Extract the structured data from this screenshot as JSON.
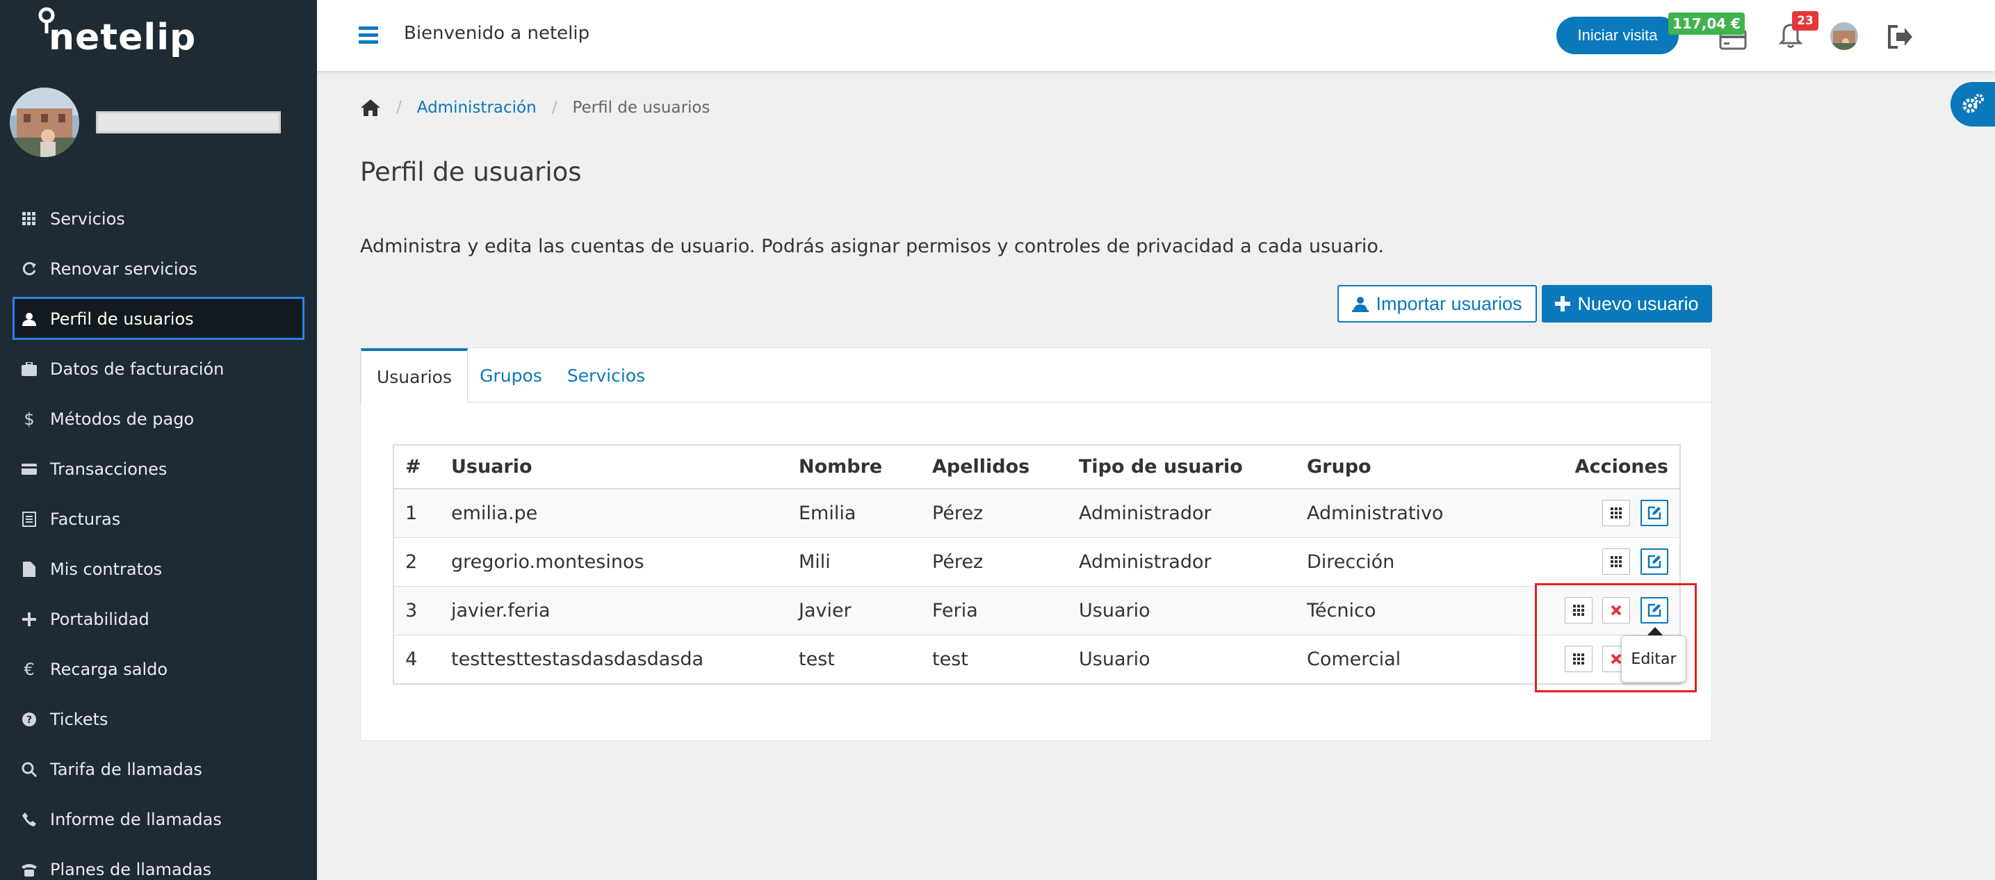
{
  "brand": {
    "name": "netelip"
  },
  "topbar": {
    "welcome": "Bienvenido a netelip",
    "visit_button": "Iniciar visita",
    "balance": "117,04 €",
    "notifications_count": "23"
  },
  "sidebar": {
    "items": [
      {
        "label": "Servicios",
        "icon": "grid-icon"
      },
      {
        "label": "Renovar servicios",
        "icon": "refresh-icon"
      },
      {
        "label": "Perfil de usuarios",
        "icon": "user-icon",
        "active": true
      },
      {
        "label": "Datos de facturación",
        "icon": "briefcase-icon"
      },
      {
        "label": "Métodos de pago",
        "icon": "dollar-icon"
      },
      {
        "label": "Transacciones",
        "icon": "credit-card-icon"
      },
      {
        "label": "Facturas",
        "icon": "list-icon"
      },
      {
        "label": "Mis contratos",
        "icon": "file-icon"
      },
      {
        "label": "Portabilidad",
        "icon": "plus-icon"
      },
      {
        "label": "Recarga saldo",
        "icon": "euro-icon"
      },
      {
        "label": "Tickets",
        "icon": "question-icon"
      },
      {
        "label": "Tarifa de llamadas",
        "icon": "search-icon"
      },
      {
        "label": "Informe de llamadas",
        "icon": "phone-icon"
      },
      {
        "label": "Planes de llamadas",
        "icon": "desk-phone-icon"
      }
    ]
  },
  "breadcrumb": {
    "admin": "Administración",
    "current": "Perfil de usuarios"
  },
  "page": {
    "title": "Perfil de usuarios",
    "intro": "Administra y edita las cuentas de usuario. Podrás asignar permisos y controles de privacidad a cada usuario.",
    "import_button": "Importar usuarios",
    "new_button": "Nuevo usuario"
  },
  "tabs": [
    "Usuarios",
    "Grupos",
    "Servicios"
  ],
  "table": {
    "headers": [
      "#",
      "Usuario",
      "Nombre",
      "Apellidos",
      "Tipo de usuario",
      "Grupo",
      "Acciones"
    ],
    "rows": [
      [
        "1",
        "emilia.pe",
        "Emilia",
        "Pérez",
        "Administrador",
        "Administrativo"
      ],
      [
        "2",
        "gregorio.montesinos",
        "Mili",
        "Pérez",
        "Administrador",
        "Dirección"
      ],
      [
        "3",
        "javier.feria",
        "Javier",
        "Feria",
        "Usuario",
        "Técnico"
      ],
      [
        "4",
        "testtesttestasdasdasdasda",
        "test",
        "test",
        "Usuario",
        "Comercial"
      ]
    ]
  },
  "tooltip": {
    "text": "Editar"
  },
  "colors": {
    "primary": "#0a78ba",
    "sidebar": "#1f2b34",
    "balance": "#3fb34f",
    "danger": "#e6343a"
  }
}
